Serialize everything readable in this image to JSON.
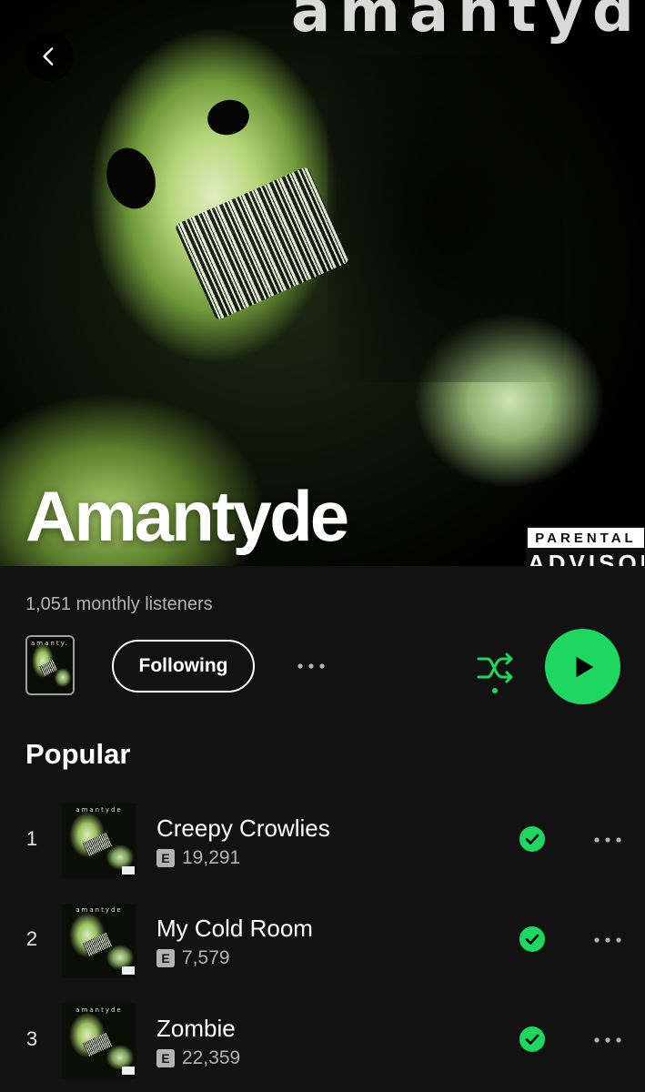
{
  "hero": {
    "top_text": "amantyde",
    "artist_name": "Amantyde",
    "advisory_line1": "PARENTAL",
    "advisory_line2": "ADVISORY"
  },
  "info": {
    "monthly_listeners": "1,051 monthly listeners",
    "follow_label": "Following"
  },
  "section": {
    "popular_title": "Popular"
  },
  "cover_label": "amantyde",
  "mini_cover_label": "amanty.",
  "tracks": [
    {
      "number": "1",
      "title": "Creepy Crowlies",
      "explicit": "E",
      "plays": "19,291"
    },
    {
      "number": "2",
      "title": "My Cold Room",
      "explicit": "E",
      "plays": "7,579"
    },
    {
      "number": "3",
      "title": "Zombie",
      "explicit": "E",
      "plays": "22,359"
    }
  ],
  "colors": {
    "background": "#121212",
    "accent_green": "#1ed760",
    "secondary_text": "#b3b3b3"
  },
  "icons": {
    "back": "chevron-left-icon",
    "more": "more-horizontal-icon",
    "shuffle": "shuffle-icon",
    "play": "play-icon",
    "downloaded": "check-circle-icon"
  }
}
